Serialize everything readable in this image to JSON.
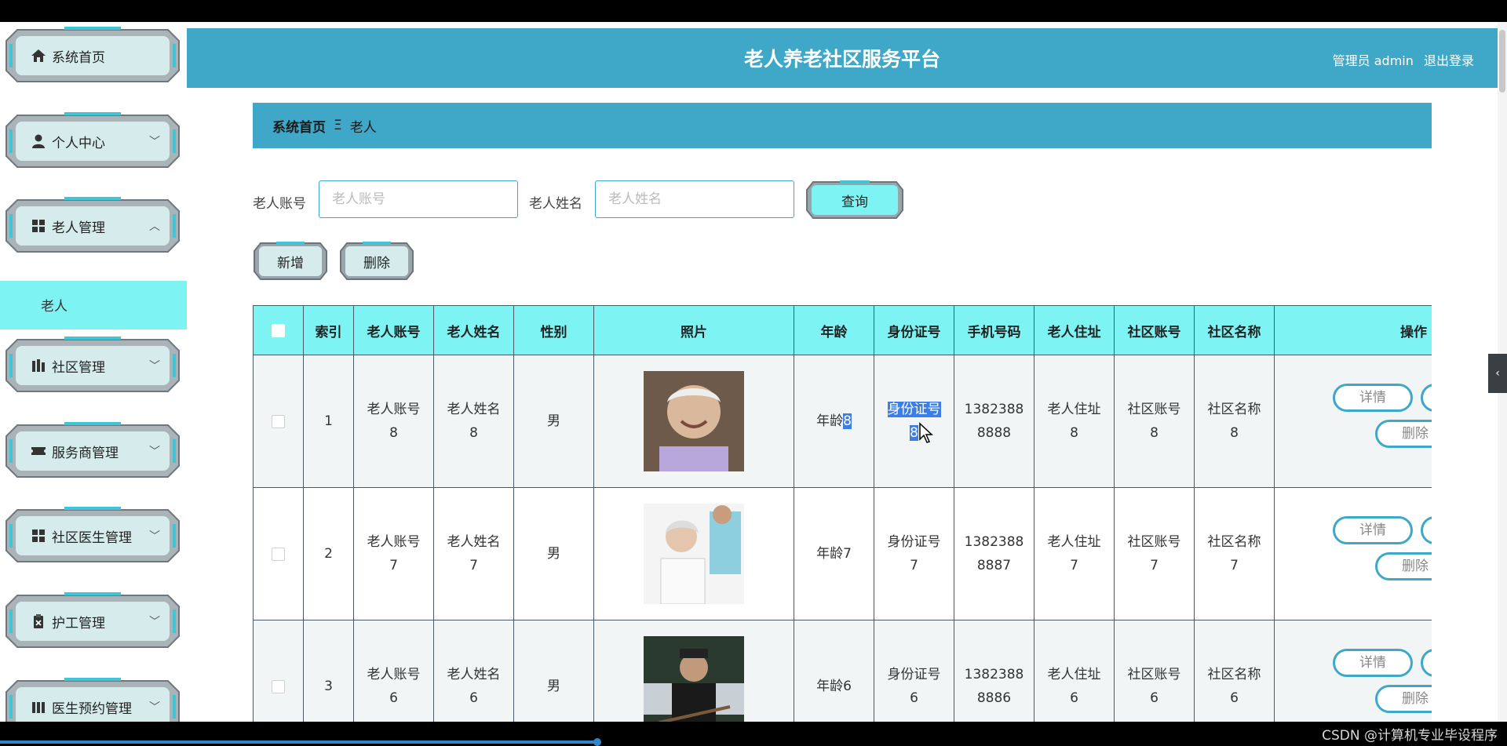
{
  "app": {
    "title": "老人养老社区服务平台",
    "user": "管理员 admin",
    "logout": "退出登录"
  },
  "colors": {
    "header": "#3fa8c8",
    "active": "#7df4f3",
    "sidebar_button": "#d6ecec",
    "selection": "#3b7ee8"
  },
  "sidebar": {
    "items": [
      {
        "label": "系统首页",
        "icon": "home-icon",
        "chevron": ""
      },
      {
        "label": "个人中心",
        "icon": "user-icon",
        "chevron": "﹀"
      },
      {
        "label": "老人管理",
        "icon": "grid-icon",
        "chevron": "︿"
      },
      {
        "label": "社区管理",
        "icon": "building-icon",
        "chevron": "﹀"
      },
      {
        "label": "服务商管理",
        "icon": "ticket-icon",
        "chevron": "﹀"
      },
      {
        "label": "社区医生管理",
        "icon": "grid-icon",
        "chevron": "﹀"
      },
      {
        "label": "护工管理",
        "icon": "clipboard-icon",
        "chevron": "﹀"
      },
      {
        "label": "医生预约管理",
        "icon": "bars-icon",
        "chevron": "﹀"
      }
    ],
    "active_sub": "老人"
  },
  "breadcrumb": {
    "home": "系统首页",
    "sep": "Ξ",
    "current": "老人"
  },
  "search": {
    "account_label": "老人账号",
    "account_placeholder": "老人账号",
    "name_label": "老人姓名",
    "name_placeholder": "老人姓名",
    "query": "查询"
  },
  "actions": {
    "add": "新增",
    "delete": "删除"
  },
  "table": {
    "columns": [
      "",
      "索引",
      "老人账号",
      "老人姓名",
      "性别",
      "照片",
      "年龄",
      "身份证号",
      "手机号码",
      "老人住址",
      "社区账号",
      "社区名称",
      "操作"
    ],
    "rows": [
      {
        "index": "1",
        "account": [
          "老人账号",
          "8"
        ],
        "name": [
          "老人姓名",
          "8"
        ],
        "gender": "男",
        "age": [
          "年龄",
          "8"
        ],
        "idcard": [
          "身份证号",
          "8"
        ],
        "phone": [
          "1382388",
          "8888"
        ],
        "address": [
          "老人住址",
          "8"
        ],
        "comm_acc": [
          "社区账号",
          "8"
        ],
        "comm_name": [
          "社区名称",
          "8"
        ]
      },
      {
        "index": "2",
        "account": [
          "老人账号",
          "7"
        ],
        "name": [
          "老人姓名",
          "7"
        ],
        "gender": "男",
        "age": [
          "年龄",
          "7"
        ],
        "idcard": [
          "身份证号",
          "7"
        ],
        "phone": [
          "1382388",
          "8887"
        ],
        "address": [
          "老人住址",
          "7"
        ],
        "comm_acc": [
          "社区账号",
          "7"
        ],
        "comm_name": [
          "社区名称",
          "7"
        ]
      },
      {
        "index": "3",
        "account": [
          "老人账号",
          "6"
        ],
        "name": [
          "老人姓名",
          "6"
        ],
        "gender": "男",
        "age": [
          "年龄",
          "6"
        ],
        "idcard": [
          "身份证号",
          "6"
        ],
        "phone": [
          "1382388",
          "8886"
        ],
        "address": [
          "老人住址",
          "6"
        ],
        "comm_acc": [
          "社区账号",
          "6"
        ],
        "comm_name": [
          "社区名称",
          "6"
        ]
      }
    ],
    "op_detail": "详情",
    "op_delete": "删除"
  },
  "footer": {
    "watermark": "CSDN @计算机专业毕设程序"
  }
}
